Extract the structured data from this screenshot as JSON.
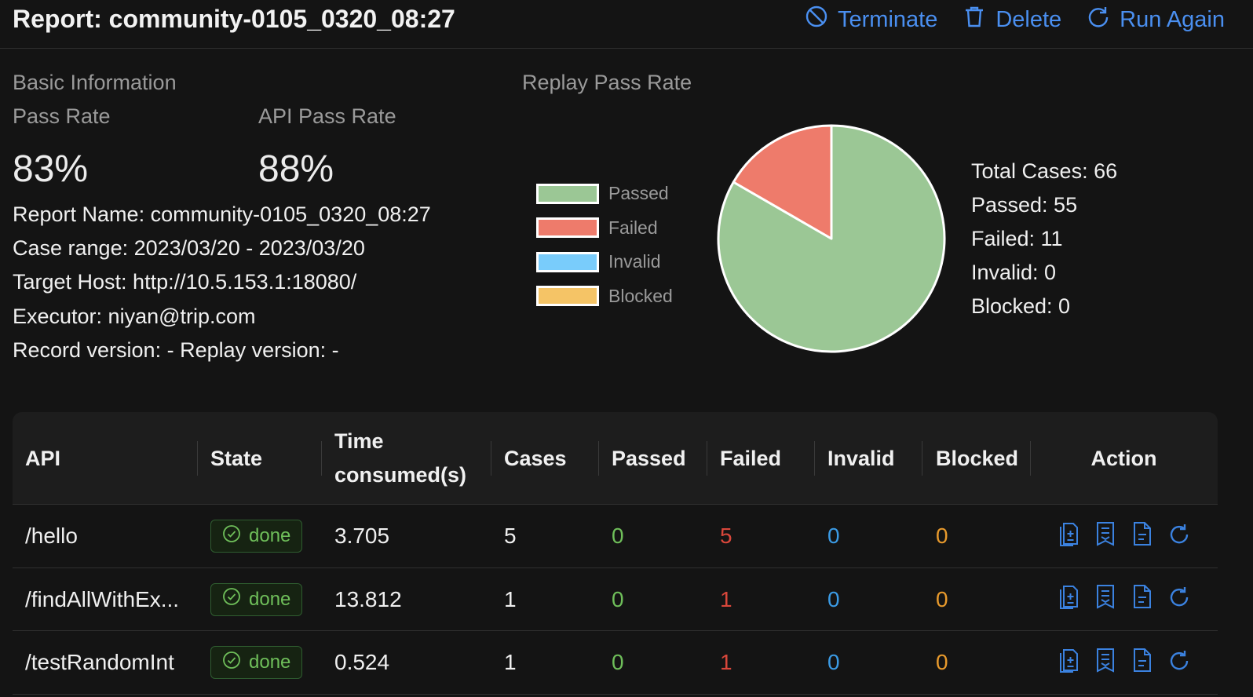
{
  "header": {
    "title": "Report: community-0105_0320_08:27",
    "terminate_label": "Terminate",
    "delete_label": "Delete",
    "run_again_label": "Run Again",
    "accent_color": "#4a8ff0"
  },
  "basic_info": {
    "section_title": "Basic Information",
    "pass_rate_label": "Pass Rate",
    "pass_rate_value": "83%",
    "api_pass_rate_label": "API Pass Rate",
    "api_pass_rate_value": "88%",
    "report_name": "Report Name: community-0105_0320_08:27",
    "case_range": "Case range: 2023/03/20 - 2023/03/20",
    "target_host": "Target Host: http://10.5.153.1:18080/",
    "executor": "Executor: niyan@trip.com",
    "versions": "Record version: - Replay version: -"
  },
  "replay": {
    "section_title": "Replay Pass Rate",
    "legend": [
      {
        "label": "Passed",
        "color": "#9bc795"
      },
      {
        "label": "Failed",
        "color": "#ee7b6b"
      },
      {
        "label": "Invalid",
        "color": "#79ccfb"
      },
      {
        "label": "Blocked",
        "color": "#f5c466"
      }
    ],
    "totals": {
      "total": "Total Cases: 66",
      "passed": "Passed: 55",
      "failed": "Failed: 11",
      "invalid": "Invalid: 0",
      "blocked": "Blocked: 0"
    }
  },
  "chart_data": {
    "type": "pie",
    "categories": [
      "Passed",
      "Failed",
      "Invalid",
      "Blocked"
    ],
    "values": [
      55,
      11,
      0,
      0
    ],
    "colors": [
      "#9bc795",
      "#ee7b6b",
      "#79ccfb",
      "#f5c466"
    ]
  },
  "table": {
    "columns": [
      "API",
      "State",
      "Time consumed(s)",
      "Cases",
      "Passed",
      "Failed",
      "Invalid",
      "Blocked",
      "Action"
    ],
    "rows": [
      {
        "api": "/hello",
        "state": "done",
        "time": "3.705",
        "cases": "5",
        "passed": "0",
        "failed": "5",
        "invalid": "0",
        "blocked": "0"
      },
      {
        "api": "/findAllWithEx...",
        "state": "done",
        "time": "13.812",
        "cases": "1",
        "passed": "0",
        "failed": "1",
        "invalid": "0",
        "blocked": "0"
      },
      {
        "api": "/testRandomInt",
        "state": "done",
        "time": "0.524",
        "cases": "1",
        "passed": "0",
        "failed": "1",
        "invalid": "0",
        "blocked": "0"
      }
    ],
    "action_icons": [
      "diff-report-icon",
      "case-list-icon",
      "document-icon",
      "rerun-icon"
    ],
    "value_colors": {
      "passed": "#6fbf5a",
      "failed": "#d9473b",
      "invalid": "#3b9be5",
      "blocked": "#e89a2c"
    }
  }
}
